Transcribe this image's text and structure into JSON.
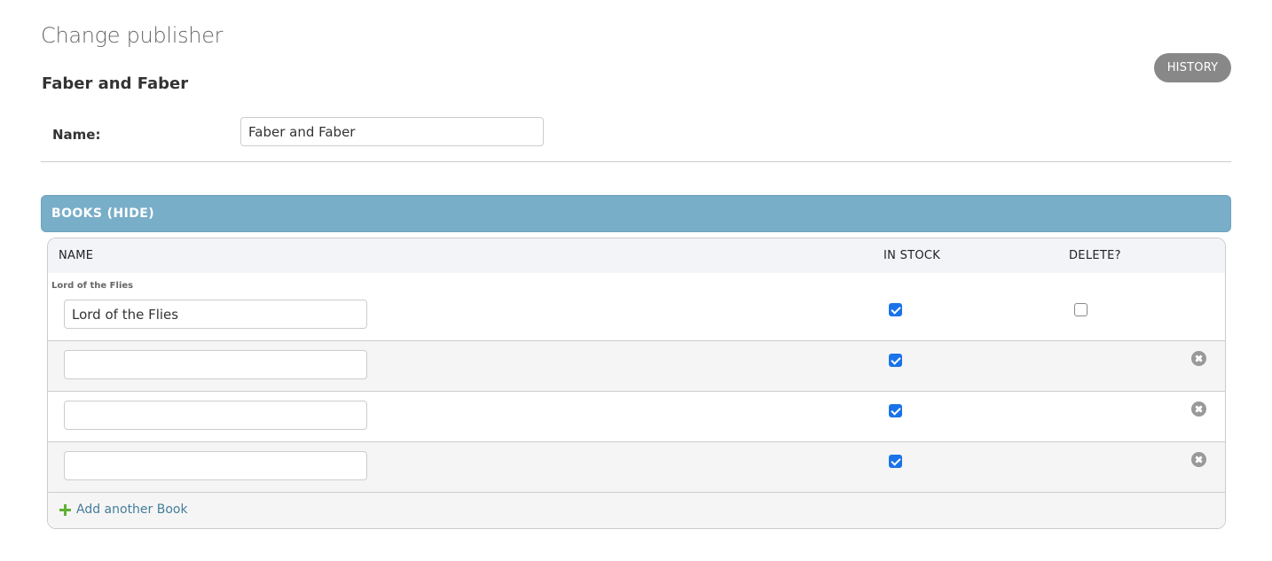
{
  "page": {
    "title": "Change publisher",
    "history_label": "HISTORY",
    "object_name": "Faber and Faber"
  },
  "form": {
    "name_label": "Name:",
    "name_value": "Faber and Faber"
  },
  "inline": {
    "header_label": "BOOKS (HIDE)",
    "columns": {
      "name": "NAME",
      "in_stock": "IN STOCK",
      "delete": "DELETE?"
    },
    "rows": [
      {
        "original": "Lord of the Flies",
        "name_value": "Lord of the Flies",
        "in_stock": true,
        "delete": false
      },
      {
        "original": "",
        "name_value": "",
        "in_stock": true
      },
      {
        "original": "",
        "name_value": "",
        "in_stock": true
      },
      {
        "original": "",
        "name_value": "",
        "in_stock": true
      }
    ],
    "add_label": "Add another Book"
  },
  "colors": {
    "inline_header_bg": "#79aec8",
    "history_bg": "#888888",
    "checkbox_checked": "#1a73e8",
    "add_plus": "#5fb133",
    "link": "#447e9b"
  }
}
